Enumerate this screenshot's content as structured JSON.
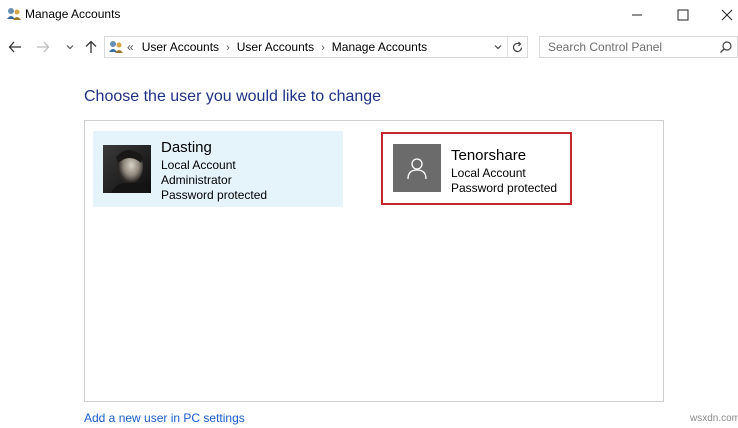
{
  "window": {
    "title": "Manage Accounts"
  },
  "address_bar": {
    "overflow": "«",
    "breadcrumbs": [
      "User Accounts",
      "User Accounts",
      "Manage Accounts"
    ],
    "separator": "›"
  },
  "search": {
    "placeholder": "Search Control Panel"
  },
  "content": {
    "heading": "Choose the user you would like to change",
    "accounts": [
      {
        "name": "Dasting",
        "lines": [
          "Local Account",
          "Administrator",
          "Password protected"
        ]
      },
      {
        "name": "Tenorshare",
        "lines": [
          "Local Account",
          "Password protected"
        ]
      }
    ],
    "add_user_link": "Add a new user in PC settings"
  },
  "watermark": "wsxdn.com",
  "colors": {
    "heading": "#1e3287",
    "link": "#1a5ccc",
    "selected_bg": "#e5f3fb",
    "highlight_border": "#c4282e"
  }
}
